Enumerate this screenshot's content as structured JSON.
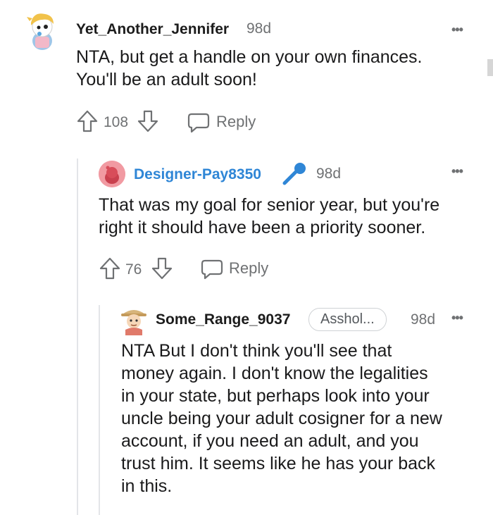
{
  "comments": [
    {
      "username": "Yet_Another_Jennifer",
      "time": "98d",
      "body_lines": [
        "NTA, but get a handle on your own finances.",
        "You'll be an adult soon!"
      ],
      "upvotes": "108",
      "reply_label": "Reply",
      "more": "•••"
    },
    {
      "username": "Designer-Pay8350",
      "is_op": true,
      "time": "98d",
      "body_lines": [
        "That was my goal for senior year, but you're",
        "right it should have been a priority sooner."
      ],
      "upvotes": "76",
      "reply_label": "Reply",
      "more": "•••",
      "badge_icon": "microphone-icon"
    },
    {
      "username": "Some_Range_9037",
      "flair": "Asshol...",
      "time": "98d",
      "body_lines": [
        "NTA But I don't think you'll see that",
        "money again. I don't know the legalities",
        "in your state, but perhaps look into your",
        "uncle being your adult cosigner for a new",
        "account, if you need an adult, and you",
        "trust him. It seems like he has your back",
        "in this."
      ],
      "more": "•••"
    }
  ],
  "colors": {
    "op_username": "#2f86d6",
    "muted": "#6f7173",
    "thread_line": "#e3e5e8"
  }
}
